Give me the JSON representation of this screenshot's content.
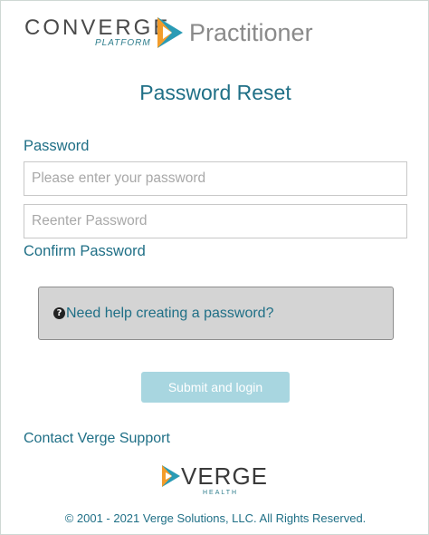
{
  "header": {
    "logo_word": "CONVERGE",
    "logo_sub": "PLATFORM",
    "product": "Practitioner"
  },
  "page": {
    "title": "Password Reset"
  },
  "form": {
    "password_label": "Password",
    "password_placeholder": "Please enter your password",
    "password_value": "",
    "reenter_placeholder": "Reenter Password",
    "reenter_value": "",
    "confirm_label": "Confirm Password",
    "help_text": "Need help creating a password?",
    "help_icon": "question-circle-icon",
    "submit_label": "Submit and login",
    "submit_enabled": false
  },
  "footer": {
    "contact_link": "Contact Verge Support",
    "brand_word": "VERGE",
    "brand_sub": "HEALTH",
    "copyright": "© 2001 - 2021 Verge Solutions, LLC. All Rights Reserved."
  },
  "colors": {
    "accent": "#1f6f86",
    "submit_disabled": "#a8d6e0",
    "help_bg": "#d4d4d4",
    "logo_orange": "#f39c2a",
    "logo_teal": "#2a9bb5"
  }
}
